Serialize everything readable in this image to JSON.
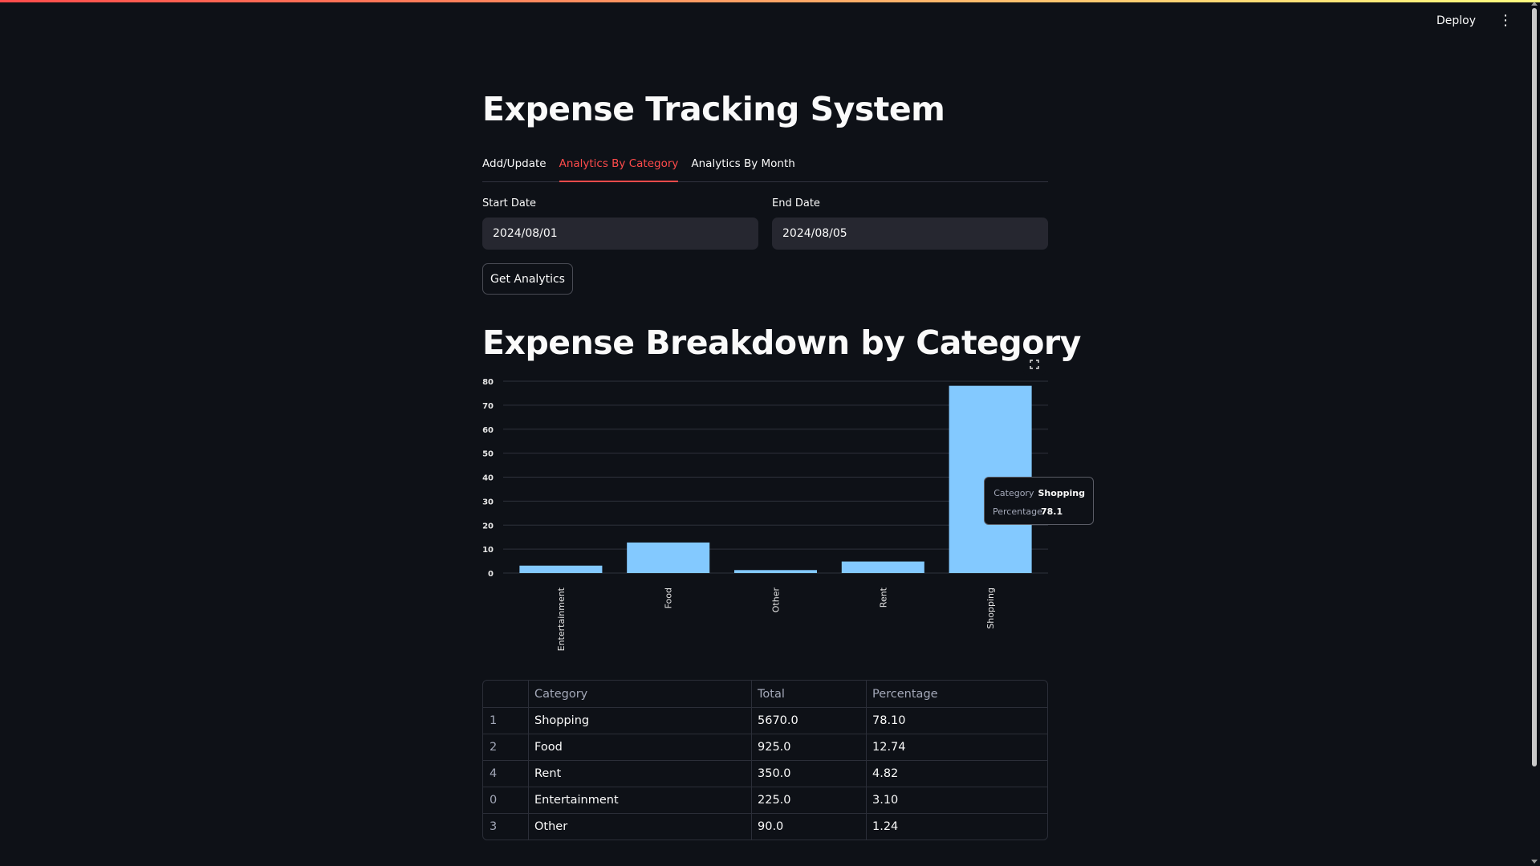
{
  "header": {
    "deploy_label": "Deploy",
    "menu_icon": "vertical-dots-icon"
  },
  "page": {
    "title": "Expense Tracking System"
  },
  "tabs": [
    {
      "label": "Add/Update",
      "active": false
    },
    {
      "label": "Analytics By Category",
      "active": true
    },
    {
      "label": "Analytics By Month",
      "active": false
    }
  ],
  "form": {
    "start_date_label": "Start Date",
    "start_date_value": "2024/08/01",
    "end_date_label": "End Date",
    "end_date_value": "2024/08/05",
    "button_label": "Get Analytics"
  },
  "chart_heading": "Expense Breakdown by Category",
  "chart_data": {
    "type": "bar",
    "categories": [
      "Entertainment",
      "Food",
      "Other",
      "Rent",
      "Shopping"
    ],
    "values": [
      3.1,
      12.74,
      1.24,
      4.82,
      78.1
    ],
    "yticks": [
      0,
      10,
      20,
      30,
      40,
      50,
      60,
      70,
      80
    ],
    "ylim": [
      0,
      80
    ],
    "grid": true,
    "bar_color": "#83c9ff",
    "tooltip": {
      "category_key": "Category",
      "category_value": "Shopping",
      "percentage_key": "Percentage",
      "percentage_value": "78.1"
    }
  },
  "table": {
    "columns": [
      "",
      "Category",
      "Total",
      "Percentage"
    ],
    "rows": [
      {
        "index": "1",
        "category": "Shopping",
        "total": "5670.0",
        "percentage": "78.10"
      },
      {
        "index": "2",
        "category": "Food",
        "total": "925.0",
        "percentage": "12.74"
      },
      {
        "index": "4",
        "category": "Rent",
        "total": "350.0",
        "percentage": "4.82"
      },
      {
        "index": "0",
        "category": "Entertainment",
        "total": "225.0",
        "percentage": "3.10"
      },
      {
        "index": "3",
        "category": "Other",
        "total": "90.0",
        "percentage": "1.24"
      }
    ]
  },
  "colors": {
    "background": "#0e1117",
    "accent": "#ff4b4b",
    "bar": "#83c9ff"
  }
}
